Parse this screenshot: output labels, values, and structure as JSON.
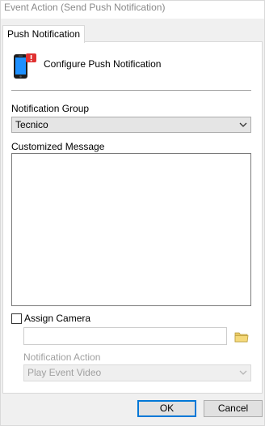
{
  "window": {
    "title": "Event Action (Send Push Notification)"
  },
  "tabs": [
    {
      "label": "Push Notification",
      "active": true
    }
  ],
  "header": {
    "title": "Configure Push Notification",
    "icon": "mobile-phone-alert-icon"
  },
  "notification_group": {
    "label": "Notification Group",
    "selected": "Tecnico"
  },
  "customized_message": {
    "label": "Customized Message",
    "value": ""
  },
  "assign_camera": {
    "label": "Assign Camera",
    "checked": false,
    "camera_value": "",
    "browse_icon": "folder-icon"
  },
  "notification_action": {
    "label": "Notification Action",
    "selected": "Play Event Video",
    "enabled": false
  },
  "buttons": {
    "ok": "OK",
    "cancel": "Cancel"
  },
  "colors": {
    "accent": "#0078d7",
    "phone_body": "#1e1e1e",
    "phone_screen": "#1e90ff",
    "alert_badge": "#e03131"
  }
}
